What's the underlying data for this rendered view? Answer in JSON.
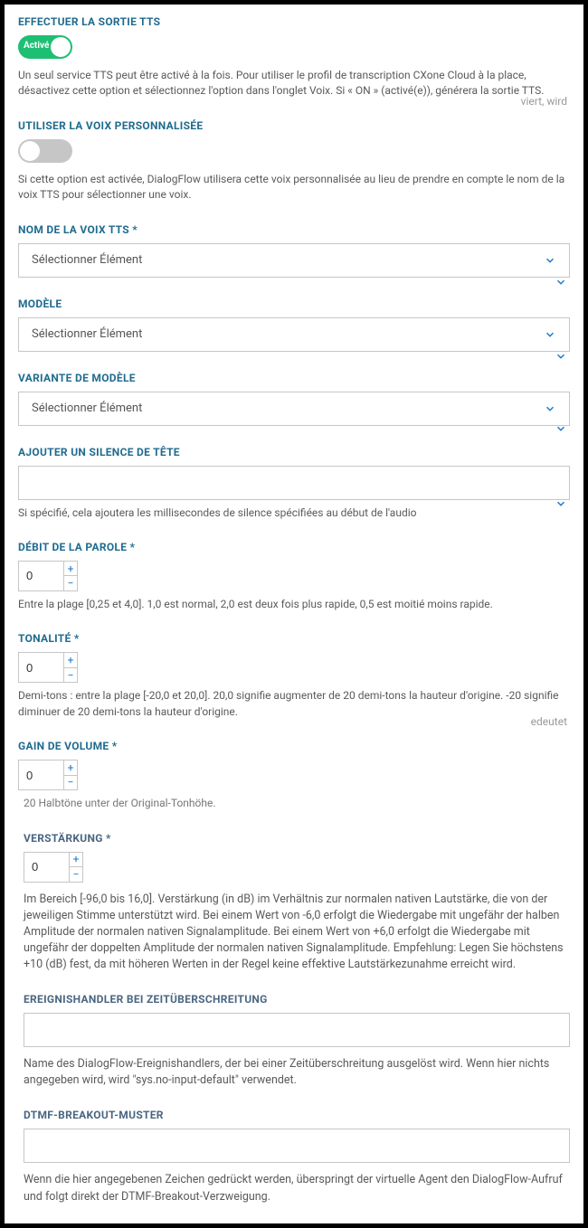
{
  "tts": {
    "label": "EFFECTUER LA SORTIE TTS",
    "toggle_text": "Activé",
    "help": "Un seul service TTS peut être activé à la fois. Pour utiliser le profil de transcription CXone Cloud à la place, désactivez cette option et sélectionnez l'option dans l'onglet Voix. Si « ON » (activé(e)), générera la sortie TTS."
  },
  "custom_voice": {
    "label": "UTILISER LA VOIX PERSONNALISÉE",
    "help": "Si cette option est activée, DialogFlow utilisera cette voix personnalisée au lieu de prendre en compte le nom de la voix TTS pour sélectionner une voix."
  },
  "voice_name": {
    "label": "NOM DE LA VOIX TTS *",
    "value": "Sélectionner Élément"
  },
  "model": {
    "label": "MODÈLE",
    "value": "Sélectionner Élément"
  },
  "model_variant": {
    "label": "VARIANTE DE MODÈLE",
    "value": "Sélectionner Élément"
  },
  "leading_silence": {
    "label": "AJOUTER UN SILENCE DE TÊTE",
    "value": "",
    "help": "Si spécifié, cela ajoutera les millisecondes de silence spécifiées au début de l'audio"
  },
  "speech_rate": {
    "label": "DÉBIT DE LA PAROLE *",
    "value": "0",
    "help": "Entre la plage [0,25 et 4,0]. 1,0 est normal, 2,0 est deux fois plus rapide, 0,5 est moitié moins rapide."
  },
  "pitch": {
    "label": "TONALITÉ *",
    "value": "0",
    "help": "Demi-tons : entre la plage [-20,0 et 20,0]. 20,0 signifie augmenter de 20 demi-tons la hauteur d'origine. -20 signifie diminuer de 20 demi-tons la hauteur d'origine."
  },
  "volume_gain": {
    "label": "GAIN DE VOLUME *",
    "value": "0",
    "help": "20 Halbtöne unter der Original-Tonhöhe."
  },
  "verstaerkung": {
    "label": "VERSTÄRKUNG *",
    "value": "0",
    "help": "Im Bereich [-96,0 bis 16,0]. Verstärkung (in dB) im Verhältnis zur normalen nativen Lautstärke, die von der jeweiligen Stimme unterstützt wird. Bei einem Wert von -6,0 erfolgt die Wiedergabe mit ungefähr der halben Amplitude der normalen nativen Signalamplitude. Bei einem Wert von +6,0 erfolgt die Wiedergabe mit ungefähr der doppelten Amplitude der normalen nativen Signalamplitude. Empfehlung: Legen Sie höchstens +10 (dB) fest, da mit höheren Werten in der Regel keine effektive Lautstärkezunahme erreicht wird."
  },
  "timeout_handler": {
    "label": "EREIGNISHANDLER BEI ZEITÜBERSCHREITUNG",
    "value": "",
    "help": "Name des DialogFlow-Ereignishandlers, der bei einer Zeitüberschreitung ausgelöst wird. Wenn hier nichts angegeben wird, wird \"sys.no-input-default\" verwendet."
  },
  "dtmf_breakout": {
    "label": "DTMF-BREAKOUT-MUSTER",
    "value": "",
    "help": "Wenn die hier angegebenen Zeichen gedrückt werden, überspringt der virtuelle Agent den DialogFlow-Aufruf und folgt direkt der DTMF-Breakout-Verzweigung."
  },
  "ghost": {
    "text1": "viert, wird",
    "text2": "edeutet"
  }
}
